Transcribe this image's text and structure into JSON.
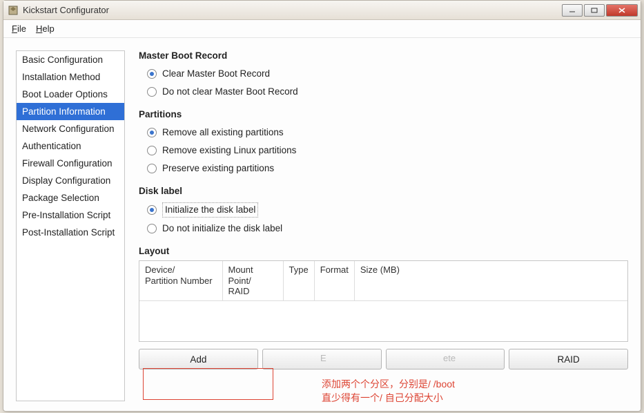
{
  "window": {
    "title": "Kickstart Configurator"
  },
  "menubar": {
    "file": "File",
    "help": "Help"
  },
  "sidebar": {
    "items": [
      {
        "label": "Basic Configuration",
        "selected": false
      },
      {
        "label": "Installation Method",
        "selected": false
      },
      {
        "label": "Boot Loader Options",
        "selected": false
      },
      {
        "label": "Partition Information",
        "selected": true
      },
      {
        "label": "Network Configuration",
        "selected": false
      },
      {
        "label": "Authentication",
        "selected": false
      },
      {
        "label": "Firewall Configuration",
        "selected": false
      },
      {
        "label": "Display Configuration",
        "selected": false
      },
      {
        "label": "Package Selection",
        "selected": false
      },
      {
        "label": "Pre-Installation Script",
        "selected": false
      },
      {
        "label": "Post-Installation Script",
        "selected": false
      }
    ]
  },
  "main": {
    "mbr": {
      "title": "Master Boot Record",
      "options": {
        "clear": "Clear Master Boot Record",
        "noclear": "Do not clear Master Boot Record"
      },
      "selected": "clear"
    },
    "partitions": {
      "title": "Partitions",
      "options": {
        "remove_all": "Remove all existing partitions",
        "remove_linux": "Remove existing Linux partitions",
        "preserve": "Preserve existing partitions"
      },
      "selected": "remove_all"
    },
    "disklabel": {
      "title": "Disk label",
      "options": {
        "init": "Initialize the disk label",
        "noinit": "Do not initialize the disk label"
      },
      "selected": "init"
    },
    "layout": {
      "title": "Layout",
      "columns": {
        "device": "Device/\nPartition Number",
        "mount": "Mount Point/\nRAID",
        "type": "Type",
        "format": "Format",
        "size": "Size (MB)"
      },
      "rows": []
    },
    "buttons": {
      "add": "Add",
      "edit": "Edit",
      "delete": "Delete",
      "raid": "RAID"
    },
    "hidden_overlapped": {
      "edit_faint": "E",
      "delete_faint": "ete"
    }
  },
  "annotation": {
    "line1": "添加两个个分区，分别是/  /boot",
    "line2": "直少得有一个/  自己分配大小"
  }
}
